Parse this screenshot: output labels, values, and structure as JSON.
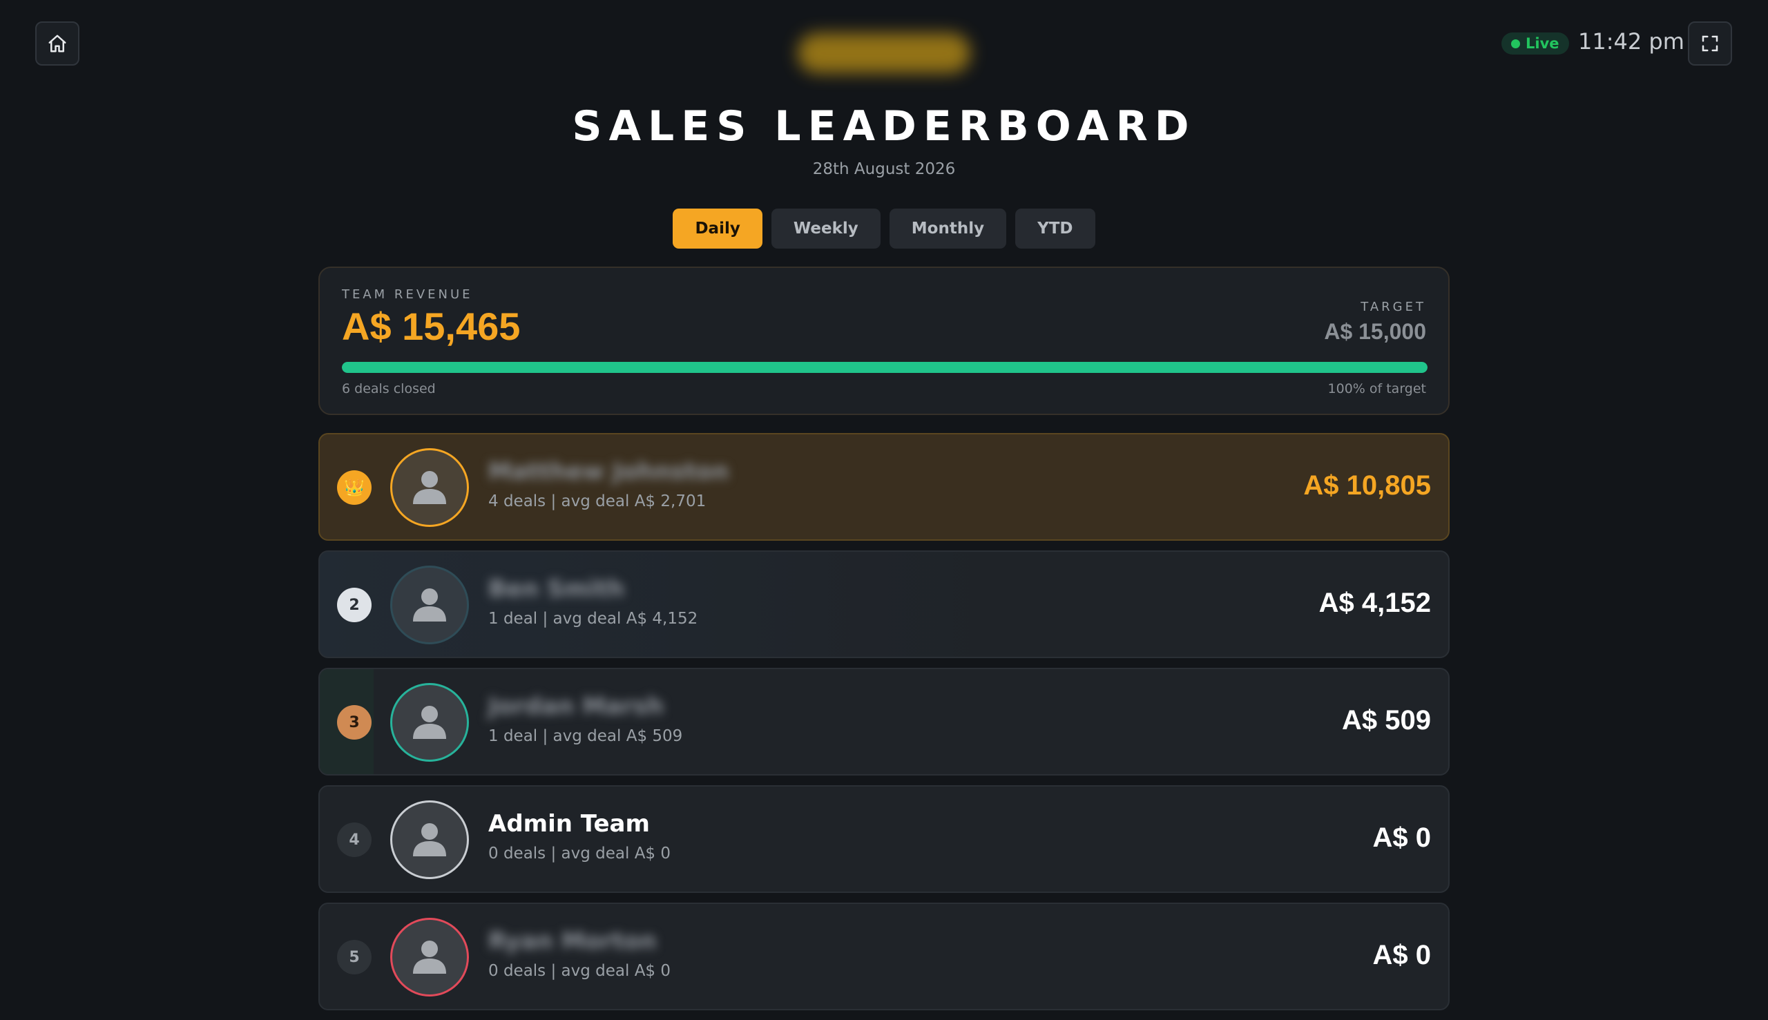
{
  "header": {
    "clock": "11:42 pm",
    "live_label": "Live",
    "title": "SALES LEADERBOARD",
    "date": "28th August 2026",
    "brand_logo": "blurred-logo"
  },
  "tabs": [
    {
      "label": "Daily",
      "active": true
    },
    {
      "label": "Weekly",
      "active": false
    },
    {
      "label": "Monthly",
      "active": false
    },
    {
      "label": "YTD",
      "active": false
    }
  ],
  "revenue": {
    "label": "TEAM REVENUE",
    "value": "A$ 15,465",
    "target_label": "TARGET",
    "target_value": "A$ 15,000",
    "progress_fraction": 1.0,
    "deals_closed": "6 deals closed",
    "pct_of_target": "100% of target"
  },
  "leaderboard": [
    {
      "rank": "👑",
      "name": "Matthew Johnston",
      "name_blurred": true,
      "meta": "4 deals | avg deal A$ 2,701",
      "amount": "A$ 10,805"
    },
    {
      "rank": "2",
      "name": "Ben Smith",
      "name_blurred": true,
      "meta": "1 deal | avg deal A$ 4,152",
      "amount": "A$ 4,152"
    },
    {
      "rank": "3",
      "name": "Jordan Marsh",
      "name_blurred": true,
      "meta": "1 deal | avg deal A$ 509",
      "amount": "A$ 509"
    },
    {
      "rank": "4",
      "name": "Admin Team",
      "name_blurred": false,
      "meta": "0 deals | avg deal A$ 0",
      "amount": "A$ 0"
    },
    {
      "rank": "5",
      "name": "Ryan Morton",
      "name_blurred": true,
      "meta": "0 deals | avg deal A$ 0",
      "amount": "A$ 0"
    }
  ],
  "icons": {
    "home": "home-icon",
    "fullscreen": "fullscreen-icon",
    "avatar": "user-silhouette-icon",
    "crown": "crown-icon"
  },
  "colors": {
    "accent": "#f5a623",
    "progress": "#20c48b",
    "live": "#22c55e",
    "background": "#121519"
  }
}
